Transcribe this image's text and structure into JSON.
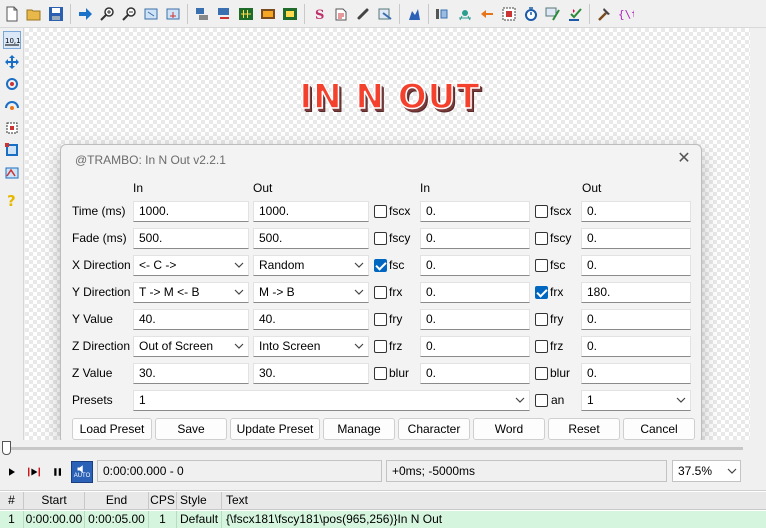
{
  "toolbar": {
    "icons": [
      "new-file",
      "open-folder",
      "save",
      "jump-to",
      "zoom-in",
      "zoom-out",
      "video-fit",
      "video-tools",
      "styles",
      "video-details",
      "audio-waveform",
      "video-frame",
      "keyframes",
      "spell-check",
      "attachments",
      "file-link",
      "assistant",
      "help",
      "export",
      "translator",
      "fonts",
      "timing-post",
      "detect-scenes",
      "automation-macros",
      "subtitle-tool",
      "abcd-tags"
    ]
  },
  "video_overlay": {
    "subtitle_text": "IN N OUT",
    "subtitle_color": "#f4412d"
  },
  "dialog": {
    "title": "@TRAMBO: In N Out v2.2.1",
    "close": "✕",
    "headers": {
      "in1": "In",
      "out1": "Out",
      "in2": "In",
      "out2": "Out"
    },
    "rows": [
      {
        "label": "Time (ms)",
        "in": "1000.",
        "out": "1000.",
        "chk1": "fscx",
        "chk1_on": false,
        "val1": "0.",
        "chk2": "fscx",
        "chk2_on": false,
        "val2": "0."
      },
      {
        "label": "Fade (ms)",
        "in": "500.",
        "out": "500.",
        "chk1": "fscy",
        "chk1_on": false,
        "val1": "0.",
        "chk2": "fscy",
        "chk2_on": false,
        "val2": "0."
      },
      {
        "label": "X Direction",
        "in": "<- C ->",
        "out": "Random",
        "chk1": "fsc",
        "chk1_on": true,
        "val1": "0.",
        "chk2": "fsc",
        "chk2_on": false,
        "val2": "0."
      },
      {
        "label": "Y Direction",
        "in": "T -> M <- B",
        "out": "M -> B",
        "chk1": "frx",
        "chk1_on": false,
        "val1": "0.",
        "chk2": "frx",
        "chk2_on": true,
        "val2": "180."
      },
      {
        "label": "Y Value",
        "in": "40.",
        "out": "40.",
        "chk1": "fry",
        "chk1_on": false,
        "val1": "0.",
        "chk2": "fry",
        "chk2_on": false,
        "val2": "0."
      },
      {
        "label": "Z Direction",
        "in": "Out of Screen",
        "out": "Into Screen",
        "chk1": "frz",
        "chk1_on": false,
        "val1": "0.",
        "chk2": "frz",
        "chk2_on": false,
        "val2": "0."
      },
      {
        "label": "Z Value",
        "in": "30.",
        "out": "30.",
        "chk1": "blur",
        "chk1_on": false,
        "val1": "0.",
        "chk2": "blur",
        "chk2_on": false,
        "val2": "0."
      }
    ],
    "presets": {
      "label": "Presets",
      "value": "1",
      "an_label": "an",
      "an_on": false,
      "an_value": "1"
    },
    "buttons": [
      "Load Preset",
      "Save",
      "Update Preset",
      "Manage",
      "Character",
      "Word",
      "Reset",
      "Cancel"
    ]
  },
  "playback": {
    "time": "0:00:00.000 - 0",
    "offset": "+0ms; -5000ms",
    "zoom": "37.5%",
    "auto_label": "AUTO"
  },
  "grid": {
    "columns": [
      "#",
      "Start",
      "End",
      "CPS",
      "Style",
      "Text"
    ],
    "rows": [
      {
        "num": "1",
        "start": "0:00:00.00",
        "end": "0:00:05.00",
        "cps": "1",
        "style": "Default",
        "text": "{\\fscx181\\fscy181\\pos(965,256)}In N Out"
      }
    ]
  }
}
